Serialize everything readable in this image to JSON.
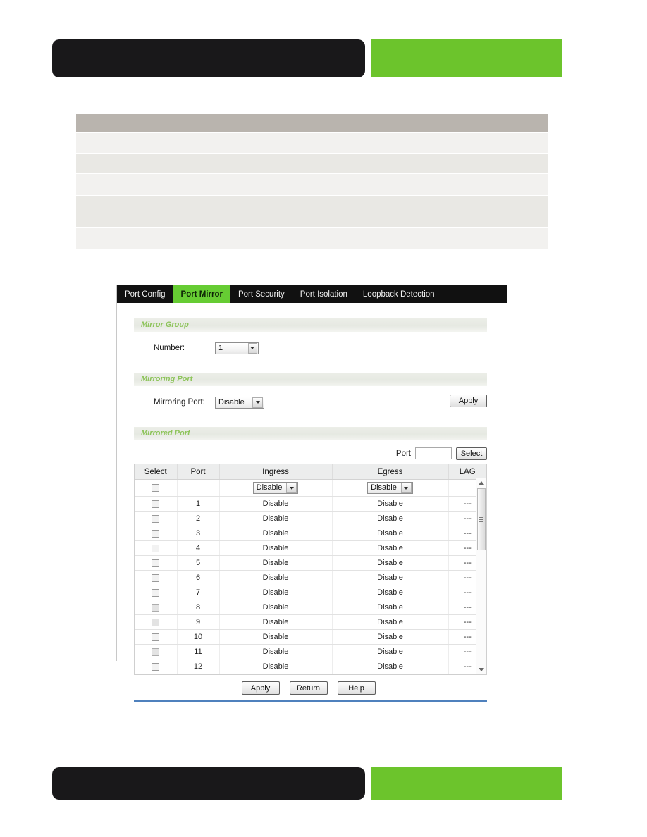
{
  "page": {
    "header_bar_dark_color": "#19181a",
    "header_bar_green_color": "#6cc42c"
  },
  "desc_table": {
    "header_cells": [
      "",
      ""
    ],
    "rows": [
      {
        "key": "",
        "value": ""
      },
      {
        "key": "",
        "value": ""
      },
      {
        "key": "",
        "value": ""
      },
      {
        "key": "",
        "value": ""
      },
      {
        "key": "",
        "value": ""
      }
    ]
  },
  "ui": {
    "tabs": [
      {
        "label": "Port Config",
        "active": false
      },
      {
        "label": "Port Mirror",
        "active": true
      },
      {
        "label": "Port Security",
        "active": false
      },
      {
        "label": "Port Isolation",
        "active": false
      },
      {
        "label": "Loopback Detection",
        "active": false
      }
    ],
    "active_tab_color": "#66cc33",
    "mirror_group": {
      "section_title": "Mirror Group",
      "number_label": "Number:",
      "number_value": "1",
      "number_options": [
        "1"
      ]
    },
    "mirroring_port": {
      "section_title": "Mirroring Port",
      "label": "Mirroring Port:",
      "value": "Disable",
      "options": [
        "Disable"
      ],
      "apply_label": "Apply"
    },
    "mirrored_port": {
      "section_title": "Mirrored Port",
      "port_search_label": "Port",
      "port_search_value": "",
      "select_button_label": "Select",
      "columns": [
        "Select",
        "Port",
        "Ingress",
        "Egress",
        "LAG"
      ],
      "bulk_row": {
        "ingress_value": "Disable",
        "egress_value": "Disable"
      },
      "rows": [
        {
          "port": "1",
          "ingress": "Disable",
          "egress": "Disable",
          "lag": "---"
        },
        {
          "port": "2",
          "ingress": "Disable",
          "egress": "Disable",
          "lag": "---"
        },
        {
          "port": "3",
          "ingress": "Disable",
          "egress": "Disable",
          "lag": "---"
        },
        {
          "port": "4",
          "ingress": "Disable",
          "egress": "Disable",
          "lag": "---"
        },
        {
          "port": "5",
          "ingress": "Disable",
          "egress": "Disable",
          "lag": "---"
        },
        {
          "port": "6",
          "ingress": "Disable",
          "egress": "Disable",
          "lag": "---"
        },
        {
          "port": "7",
          "ingress": "Disable",
          "egress": "Disable",
          "lag": "---"
        },
        {
          "port": "8",
          "ingress": "Disable",
          "egress": "Disable",
          "lag": "---"
        },
        {
          "port": "9",
          "ingress": "Disable",
          "egress": "Disable",
          "lag": "---"
        },
        {
          "port": "10",
          "ingress": "Disable",
          "egress": "Disable",
          "lag": "---"
        },
        {
          "port": "11",
          "ingress": "Disable",
          "egress": "Disable",
          "lag": "---"
        },
        {
          "port": "12",
          "ingress": "Disable",
          "egress": "Disable",
          "lag": "---"
        }
      ]
    },
    "footer_buttons": [
      {
        "label": "Apply"
      },
      {
        "label": "Return"
      },
      {
        "label": "Help"
      }
    ]
  }
}
